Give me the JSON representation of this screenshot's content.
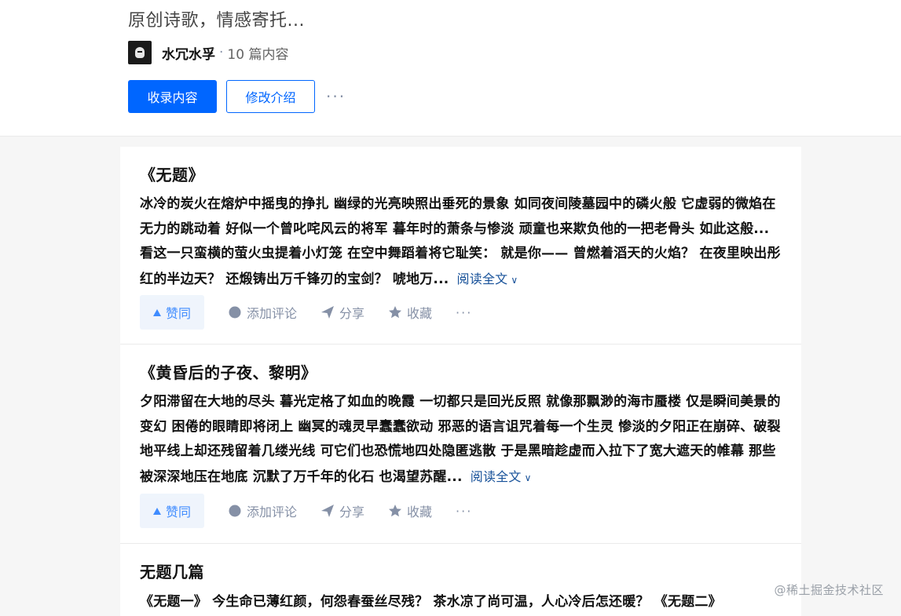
{
  "column": {
    "title": "原创诗歌，情感寄托...",
    "author_name": "水冗水孚",
    "author_separator": "·",
    "content_count": "10 篇内容",
    "primary_button": "收录内容",
    "secondary_button": "修改介绍",
    "more_label": "···"
  },
  "posts": [
    {
      "title": "《无题》",
      "excerpt": "冰冷的炭火在熔炉中摇曳的挣扎 幽绿的光亮映照出垂死的景象 如同夜间陵墓园中的磷火般 它虚弱的微焰在无力的跳动着 好似一个曾叱咤风云的将军 暮年时的萧条与惨淡 顽童也来欺负他的一把老骨头 如此这般... 看这一只蛮横的萤火虫提着小灯笼 在空中舞蹈着将它耻笑： 就是你—— 曾燃着滔天的火焰？ 在夜里映出彤红的半边天？ 还煅铸出万千锋刃的宝剑？ 唬地万...",
      "read_more": "阅读全文"
    },
    {
      "title": "《黄昏后的子夜、黎明》",
      "excerpt": "夕阳滞留在大地的尽头 暮光定格了如血的晚霞 一切都只是回光反照 就像那飘渺的海市蜃楼 仅是瞬间美景的变幻 困倦的眼睛即将闭上 幽冥的魂灵早蠢蠢欲动 邪恶的语言诅咒着每一个生灵 惨淡的夕阳正在崩碎、破裂 地平线上却还残留着几缕光线 可它们也恐慌地四处隐匿逃散 于是黑暗趁虚而入拉下了宽大遮天的帷幕 那些被深深地压在地底 沉默了万千年的化石 也渴望苏醒...",
      "read_more": "阅读全文"
    },
    {
      "title": "无题几篇",
      "excerpt": "《无题一》 今生命已薄红颜，何怨春蚕丝尽残？ 茶水凉了尚可温，人心冷后怎还暖？ 《无题二》"
    }
  ],
  "actions": {
    "vote": "赞同",
    "comment": "添加评论",
    "share": "分享",
    "favorite": "收藏",
    "more": "···"
  },
  "watermark": "@稀土掘金技术社区",
  "colors": {
    "primary": "#0066ff",
    "link": "#175199",
    "muted": "#8590a6"
  }
}
